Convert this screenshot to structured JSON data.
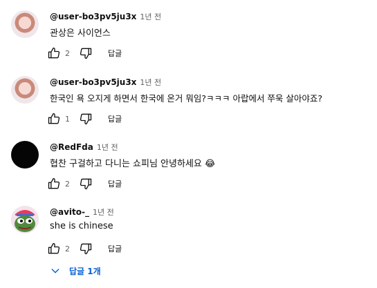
{
  "comments": [
    {
      "author": "@user-bo3pv5ju3x",
      "time": "1년 전",
      "text": "관상은 사이언스",
      "likes": "2",
      "reply_label": "답글",
      "avatar": "girl-avatar"
    },
    {
      "author": "@user-bo3pv5ju3x",
      "time": "1년 전",
      "text": "한국인 욕 오지게 하면서 한국에 온거 뭐임?ㅋㅋㅋ 아랍에서 쭈욱 살아야죠?",
      "likes": "1",
      "reply_label": "답글",
      "avatar": "girl-avatar"
    },
    {
      "author": "@RedFda",
      "time": "1년 전",
      "text": "협찬 구걸하고 다니는 쇼피님 안녕하세요 😂",
      "likes": "2",
      "reply_label": "답글",
      "avatar": "black-avatar"
    },
    {
      "author": "@avito-_",
      "time": "1년 전",
      "text": "she is chinese",
      "likes": "2",
      "reply_label": "답글",
      "avatar": "pepe-avatar"
    }
  ],
  "replies_toggle": {
    "label": "답글 1개",
    "icon": "chevron-down-icon"
  },
  "colors": {
    "link": "#065fd4",
    "secondary_text": "#606060",
    "text": "#0f0f0f"
  }
}
